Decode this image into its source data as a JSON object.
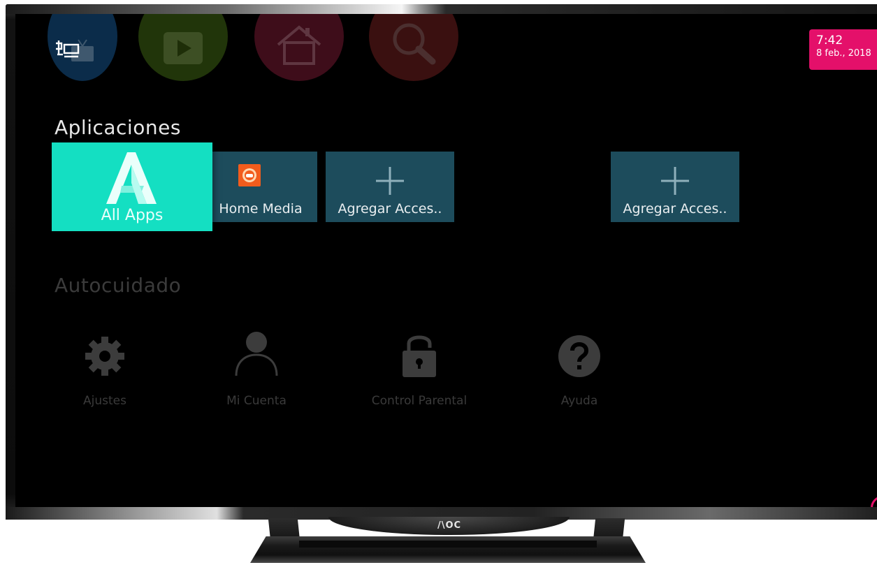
{
  "device": {
    "brand": "/\\OC"
  },
  "top_nav": {
    "items": [
      "tv-icon",
      "play-icon",
      "home-icon",
      "search-icon"
    ]
  },
  "status": {
    "time": "7:42",
    "date": "8 feb., 2018",
    "badge_color": "#e4106a"
  },
  "apps_section": {
    "title": "Aplicaciones",
    "tiles": [
      {
        "label": "All Apps",
        "icon": "all-apps-a-icon",
        "color": "#14dfc2",
        "focused": true
      },
      {
        "label": "Home Media",
        "icon": "home-media-icon",
        "color": "#1d4c5c"
      },
      {
        "label": "Agregar Acces..",
        "icon": "plus-icon",
        "color": "#1d4c5c"
      },
      {
        "label": "Agregar Acces..",
        "icon": "plus-icon",
        "color": "#1d4c5c"
      }
    ]
  },
  "care_section": {
    "title": "Autocuidado",
    "items": [
      {
        "label": "Ajustes",
        "icon": "gear-icon"
      },
      {
        "label": "Mi Cuenta",
        "icon": "user-icon"
      },
      {
        "label": "Control Parental",
        "icon": "lock-icon"
      },
      {
        "label": "Ayuda",
        "icon": "help-icon"
      }
    ]
  }
}
